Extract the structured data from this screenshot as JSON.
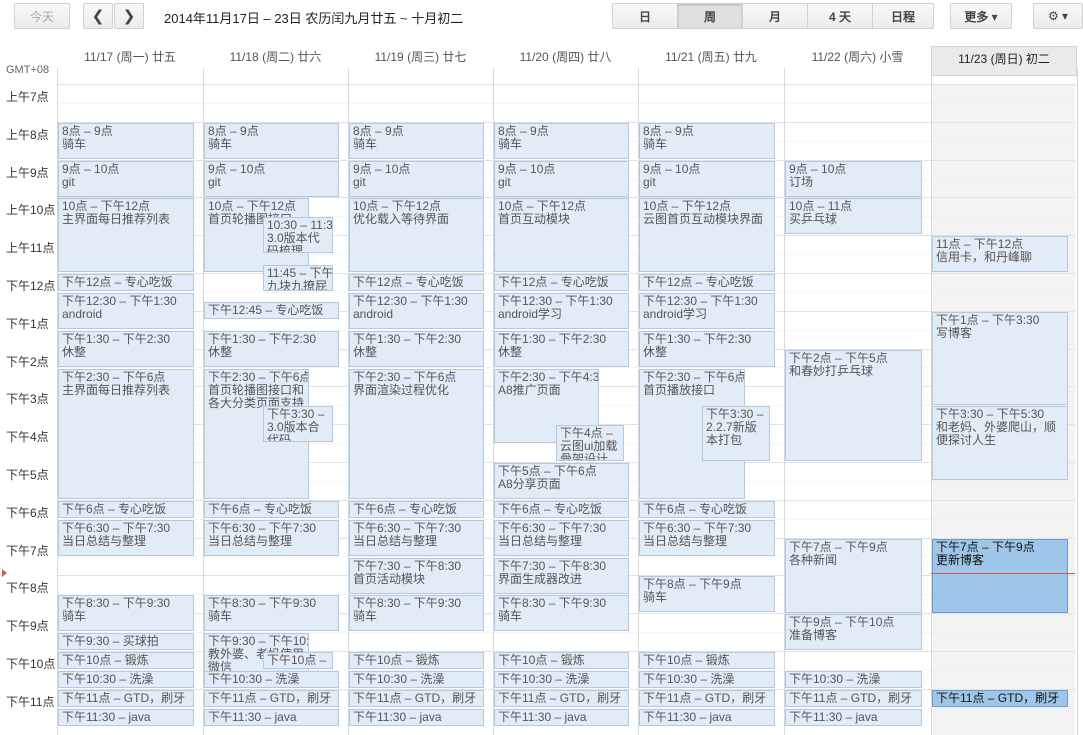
{
  "toolbar": {
    "today": "今天",
    "prev": "❮",
    "next": "❯",
    "range": "2014年11月17日 – 23日 农历闰九月廿五 ~ 十月初二",
    "views": [
      "日",
      "周",
      "月",
      "4 天",
      "日程"
    ],
    "selected_view": "周",
    "more": "更多 ▾",
    "settings": "⚙ ▾"
  },
  "timezone": "GMT+08",
  "days": [
    "11/17 (周一) 廿五",
    "11/18 (周二) 廿六",
    "11/19 (周三) 廿七",
    "11/20 (周四) 廿八",
    "11/21 (周五) 廿九",
    "11/22 (周六) 小雪",
    "11/23 (周日) 初二"
  ],
  "today_index": 6,
  "hours": [
    "上午7点",
    "上午8点",
    "上午9点",
    "上午10点",
    "上午11点",
    "下午12点",
    "下午1点",
    "下午2点",
    "下午3点",
    "下午4点",
    "下午5点",
    "下午6点",
    "下午7点",
    "下午8点",
    "下午9点",
    "下午10点",
    "下午11点"
  ],
  "colors": {
    "event_bg": "#e2ecf7",
    "event_border": "#b2c9e1",
    "highlight": "#9fc6e8",
    "now_line": "#dd5544"
  },
  "events": [
    {
      "day": 0,
      "s": 8,
      "e": 9,
      "time": "8点 – 9点",
      "title": "骑车"
    },
    {
      "day": 0,
      "s": 9,
      "e": 10,
      "time": "9点 – 10点",
      "title": "git"
    },
    {
      "day": 0,
      "s": 10,
      "e": 12,
      "time": "10点 – 下午12点",
      "title": "主界面每日推荐列表"
    },
    {
      "day": 0,
      "s": 12,
      "e": 12.5,
      "time": "下午12点 – 专心吃饭",
      "title": ""
    },
    {
      "day": 0,
      "s": 12.5,
      "e": 13.5,
      "time": "下午12:30 – 下午1:30",
      "title": "android"
    },
    {
      "day": 0,
      "s": 13.5,
      "e": 14.5,
      "time": "下午1:30 – 下午2:30",
      "title": "休整"
    },
    {
      "day": 0,
      "s": 14.5,
      "e": 18,
      "time": "下午2:30 – 下午6点",
      "title": "主界面每日推荐列表"
    },
    {
      "day": 0,
      "s": 18,
      "e": 18.5,
      "time": "下午6点 – 专心吃饭",
      "title": ""
    },
    {
      "day": 0,
      "s": 18.5,
      "e": 19.5,
      "time": "下午6:30 – 下午7:30",
      "title": "当日总结与整理"
    },
    {
      "day": 0,
      "s": 20.5,
      "e": 21.5,
      "time": "下午8:30 – 下午9:30",
      "title": "骑车"
    },
    {
      "day": 0,
      "s": 21.5,
      "e": 22,
      "time": "下午9:30 – 买球拍",
      "title": ""
    },
    {
      "day": 0,
      "s": 22,
      "e": 22.5,
      "time": "下午10点 – 锻炼",
      "title": ""
    },
    {
      "day": 0,
      "s": 22.5,
      "e": 23,
      "time": "下午10:30 – 洗澡",
      "title": ""
    },
    {
      "day": 0,
      "s": 23,
      "e": 23.5,
      "time": "下午11点 – GTD，刷牙",
      "title": ""
    },
    {
      "day": 0,
      "s": 23.5,
      "e": 24,
      "time": "下午11:30 – java",
      "title": ""
    },
    {
      "day": 1,
      "s": 8,
      "e": 9,
      "time": "8点 – 9点",
      "title": "骑车"
    },
    {
      "day": 1,
      "s": 9,
      "e": 10,
      "time": "9点 – 10点",
      "title": "git"
    },
    {
      "day": 1,
      "s": 10,
      "e": 12,
      "time": "10点 – 下午12点",
      "title": "首页轮播图接口",
      "w": 0.78
    },
    {
      "day": 1,
      "s": 10.5,
      "e": 11.5,
      "time": "10:30 – 11:30",
      "title": "3.0版本代码梳理",
      "l": 0.44,
      "w": 0.52
    },
    {
      "day": 1,
      "s": 11.75,
      "e": 12.5,
      "time": "11:45 – 下午12:30",
      "title": "九块九撩屁股",
      "l": 0.44,
      "w": 0.52
    },
    {
      "day": 1,
      "s": 12.75,
      "e": 13.25,
      "time": "下午12:45 – 专心吃饭",
      "title": ""
    },
    {
      "day": 1,
      "s": 13.5,
      "e": 14.5,
      "time": "下午1:30 – 下午2:30",
      "title": "休整"
    },
    {
      "day": 1,
      "s": 14.5,
      "e": 18,
      "time": "下午2:30 – 下午6点",
      "title": "首页轮播图接口和各大分类页面支持",
      "w": 0.78
    },
    {
      "day": 1,
      "s": 15.5,
      "e": 16.5,
      "time": "下午3:30 –",
      "title": "3.0版本合代码",
      "l": 0.44,
      "w": 0.52
    },
    {
      "day": 1,
      "s": 18,
      "e": 18.5,
      "time": "下午6点 – 专心吃饭",
      "title": ""
    },
    {
      "day": 1,
      "s": 18.5,
      "e": 19.5,
      "time": "下午6:30 – 下午7:30",
      "title": "当日总结与整理"
    },
    {
      "day": 1,
      "s": 20.5,
      "e": 21.5,
      "time": "下午8:30 – 下午9:30",
      "title": "骑车"
    },
    {
      "day": 1,
      "s": 21.5,
      "e": 23,
      "time": "下午9:30 – 下午10:30",
      "title": "教外婆、老妈使用微信",
      "w": 0.78
    },
    {
      "day": 1,
      "s": 22,
      "e": 22.5,
      "time": "下午10点 –",
      "title": "",
      "l": 0.44,
      "w": 0.52
    },
    {
      "day": 1,
      "s": 22.5,
      "e": 23,
      "time": "下午10:30 – 洗澡",
      "title": ""
    },
    {
      "day": 1,
      "s": 23,
      "e": 23.5,
      "time": "下午11点 – GTD，刷牙",
      "title": ""
    },
    {
      "day": 1,
      "s": 23.5,
      "e": 24,
      "time": "下午11:30 – java",
      "title": ""
    },
    {
      "day": 2,
      "s": 8,
      "e": 9,
      "time": "8点 – 9点",
      "title": "骑车"
    },
    {
      "day": 2,
      "s": 9,
      "e": 10,
      "time": "9点 – 10点",
      "title": "git"
    },
    {
      "day": 2,
      "s": 10,
      "e": 12,
      "time": "10点 – 下午12点",
      "title": "优化载入等待界面"
    },
    {
      "day": 2,
      "s": 12,
      "e": 12.5,
      "time": "下午12点 – 专心吃饭",
      "title": ""
    },
    {
      "day": 2,
      "s": 12.5,
      "e": 13.5,
      "time": "下午12:30 – 下午1:30",
      "title": "android"
    },
    {
      "day": 2,
      "s": 13.5,
      "e": 14.5,
      "time": "下午1:30 – 下午2:30",
      "title": "休整"
    },
    {
      "day": 2,
      "s": 14.5,
      "e": 18,
      "time": "下午2:30 – 下午6点",
      "title": "界面渲染过程优化"
    },
    {
      "day": 2,
      "s": 18,
      "e": 18.5,
      "time": "下午6点 – 专心吃饭",
      "title": ""
    },
    {
      "day": 2,
      "s": 18.5,
      "e": 19.5,
      "time": "下午6:30 – 下午7:30",
      "title": "当日总结与整理"
    },
    {
      "day": 2,
      "s": 19.5,
      "e": 20.5,
      "time": "下午7:30 – 下午8:30",
      "title": "首页活动模块"
    },
    {
      "day": 2,
      "s": 20.5,
      "e": 21.5,
      "time": "下午8:30 – 下午9:30",
      "title": "骑车"
    },
    {
      "day": 2,
      "s": 22,
      "e": 22.5,
      "time": "下午10点 – 锻炼",
      "title": ""
    },
    {
      "day": 2,
      "s": 22.5,
      "e": 23,
      "time": "下午10:30 – 洗澡",
      "title": ""
    },
    {
      "day": 2,
      "s": 23,
      "e": 23.5,
      "time": "下午11点 – GTD，刷牙",
      "title": ""
    },
    {
      "day": 2,
      "s": 23.5,
      "e": 24,
      "time": "下午11:30 – java",
      "title": ""
    },
    {
      "day": 3,
      "s": 8,
      "e": 9,
      "time": "8点 – 9点",
      "title": "骑车"
    },
    {
      "day": 3,
      "s": 9,
      "e": 10,
      "time": "9点 – 10点",
      "title": "git"
    },
    {
      "day": 3,
      "s": 10,
      "e": 12,
      "time": "10点 – 下午12点",
      "title": "首页互动模块"
    },
    {
      "day": 3,
      "s": 12,
      "e": 12.5,
      "time": "下午12点 – 专心吃饭",
      "title": ""
    },
    {
      "day": 3,
      "s": 12.5,
      "e": 13.5,
      "time": "下午12:30 – 下午1:30",
      "title": "android学习"
    },
    {
      "day": 3,
      "s": 13.5,
      "e": 14.5,
      "time": "下午1:30 – 下午2:30",
      "title": "休整"
    },
    {
      "day": 3,
      "s": 14.5,
      "e": 16.5,
      "time": "下午2:30 – 下午4:30",
      "title": "A8推广页面",
      "w": 0.78
    },
    {
      "day": 3,
      "s": 16,
      "e": 17,
      "time": "下午4点 –",
      "title": "云图ui加载骨架设计",
      "l": 0.46,
      "w": 0.5
    },
    {
      "day": 3,
      "s": 17,
      "e": 18,
      "time": "下午5点 – 下午6点",
      "title": "A8分享页面"
    },
    {
      "day": 3,
      "s": 18,
      "e": 18.5,
      "time": "下午6点 – 专心吃饭",
      "title": ""
    },
    {
      "day": 3,
      "s": 18.5,
      "e": 19.5,
      "time": "下午6:30 – 下午7:30",
      "title": "当日总结与整理"
    },
    {
      "day": 3,
      "s": 19.5,
      "e": 20.5,
      "time": "下午7:30 – 下午8:30",
      "title": "界面生成器改进"
    },
    {
      "day": 3,
      "s": 20.5,
      "e": 21.5,
      "time": "下午8:30 – 下午9:30",
      "title": "骑车"
    },
    {
      "day": 3,
      "s": 22,
      "e": 22.5,
      "time": "下午10点 – 锻炼",
      "title": ""
    },
    {
      "day": 3,
      "s": 22.5,
      "e": 23,
      "time": "下午10:30 – 洗澡",
      "title": ""
    },
    {
      "day": 3,
      "s": 23,
      "e": 23.5,
      "time": "下午11点 – GTD，刷牙",
      "title": ""
    },
    {
      "day": 3,
      "s": 23.5,
      "e": 24,
      "time": "下午11:30 – java",
      "title": ""
    },
    {
      "day": 4,
      "s": 8,
      "e": 9,
      "time": "8点 – 9点",
      "title": "骑车"
    },
    {
      "day": 4,
      "s": 9,
      "e": 10,
      "time": "9点 – 10点",
      "title": "git"
    },
    {
      "day": 4,
      "s": 10,
      "e": 12,
      "time": "10点 – 下午12点",
      "title": "云图首页互动模块界面"
    },
    {
      "day": 4,
      "s": 12,
      "e": 12.5,
      "time": "下午12点 – 专心吃饭",
      "title": ""
    },
    {
      "day": 4,
      "s": 12.5,
      "e": 13.5,
      "time": "下午12:30 – 下午1:30",
      "title": "android学习"
    },
    {
      "day": 4,
      "s": 13.5,
      "e": 14.5,
      "time": "下午1:30 – 下午2:30",
      "title": "休整"
    },
    {
      "day": 4,
      "s": 14.5,
      "e": 18,
      "time": "下午2:30 – 下午6点",
      "title": "首页播放接口",
      "w": 0.78
    },
    {
      "day": 4,
      "s": 15.5,
      "e": 17,
      "time": "下午3:30 –",
      "title": "2.2.7新版本打包",
      "l": 0.46,
      "w": 0.5
    },
    {
      "day": 4,
      "s": 18,
      "e": 18.5,
      "time": "下午6点 – 专心吃饭",
      "title": ""
    },
    {
      "day": 4,
      "s": 18.5,
      "e": 19.5,
      "time": "下午6:30 – 下午7:30",
      "title": "当日总结与整理"
    },
    {
      "day": 4,
      "s": 20,
      "e": 21,
      "time": "下午8点 – 下午9点",
      "title": "骑车"
    },
    {
      "day": 4,
      "s": 22,
      "e": 22.5,
      "time": "下午10点 – 锻炼",
      "title": ""
    },
    {
      "day": 4,
      "s": 22.5,
      "e": 23,
      "time": "下午10:30 – 洗澡",
      "title": ""
    },
    {
      "day": 4,
      "s": 23,
      "e": 23.5,
      "time": "下午11点 – GTD，刷牙",
      "title": ""
    },
    {
      "day": 4,
      "s": 23.5,
      "e": 24,
      "time": "下午11:30 – java",
      "title": ""
    },
    {
      "day": 5,
      "s": 9,
      "e": 10,
      "time": "9点 – 10点",
      "title": "订场"
    },
    {
      "day": 5,
      "s": 10,
      "e": 11,
      "time": "10点 – 11点",
      "title": "买乒乓球"
    },
    {
      "day": 5,
      "s": 14,
      "e": 17,
      "time": "下午2点 – 下午5点",
      "title": "和春妙打乒乓球"
    },
    {
      "day": 5,
      "s": 19,
      "e": 21,
      "time": "下午7点 – 下午9点",
      "title": "各种新闻"
    },
    {
      "day": 5,
      "s": 21,
      "e": 22,
      "time": "下午9点 – 下午10点",
      "title": "准备博客"
    },
    {
      "day": 5,
      "s": 22.5,
      "e": 23,
      "time": "下午10:30 – 洗澡",
      "title": ""
    },
    {
      "day": 5,
      "s": 23,
      "e": 23.5,
      "time": "下午11点 – GTD，刷牙",
      "title": ""
    },
    {
      "day": 5,
      "s": 23.5,
      "e": 24,
      "time": "下午11:30 – java",
      "title": ""
    },
    {
      "day": 6,
      "s": 11,
      "e": 12,
      "time": "11点 – 下午12点",
      "title": "信用卡，和丹峰聊"
    },
    {
      "day": 6,
      "s": 13,
      "e": 15.5,
      "time": "下午1点 – 下午3:30",
      "title": "写博客"
    },
    {
      "day": 6,
      "s": 15.5,
      "e": 17.5,
      "time": "下午3:30 – 下午5:30",
      "title": "和老妈、外婆爬山，顺便探讨人生"
    },
    {
      "day": 6,
      "s": 19,
      "e": 21,
      "time": "下午7点 – 下午9点",
      "title": "更新博客",
      "hi": true
    },
    {
      "day": 6,
      "s": 23,
      "e": 23.5,
      "time": "下午11点 – GTD，刷牙",
      "title": "",
      "hi": true
    }
  ]
}
